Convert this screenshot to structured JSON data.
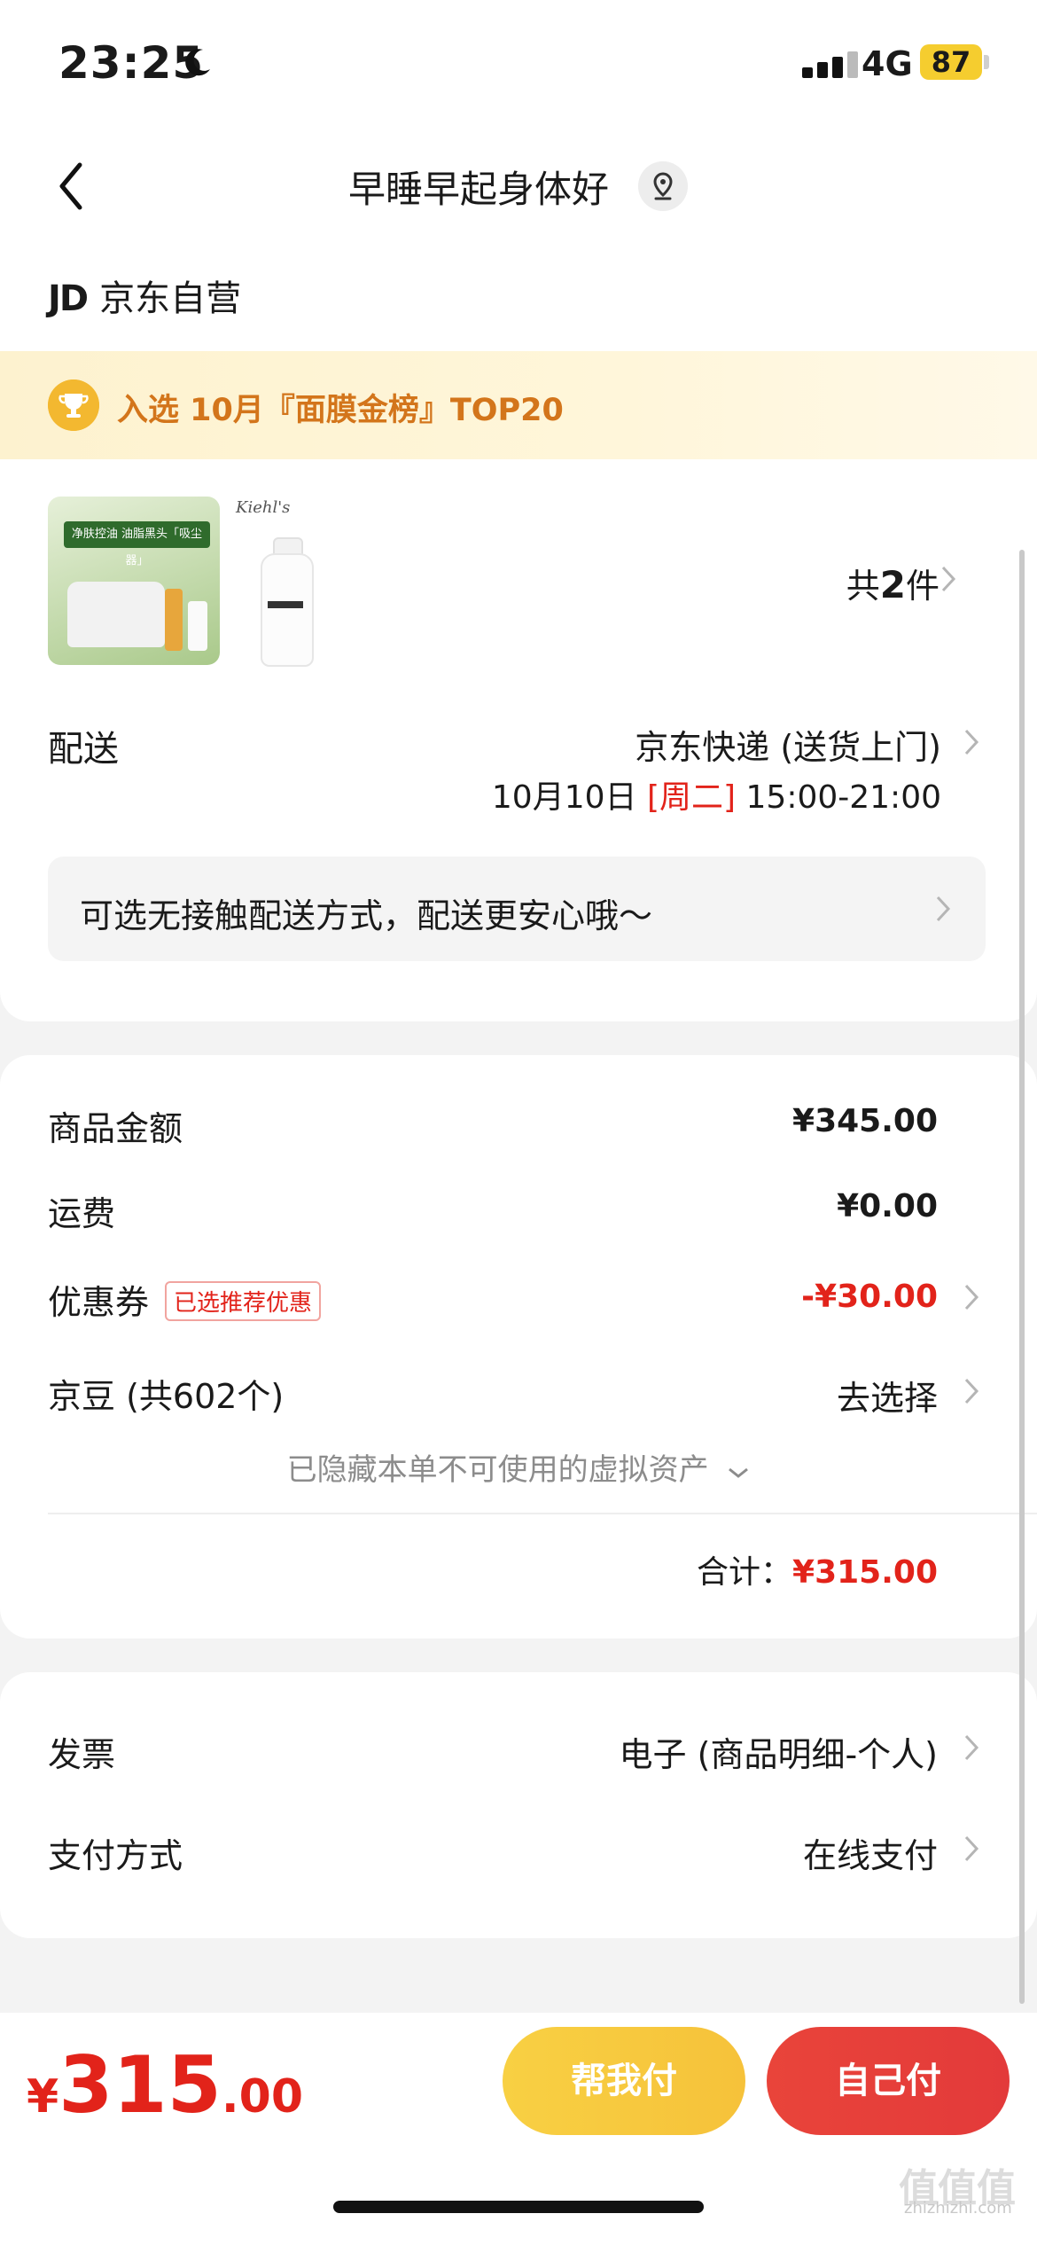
{
  "status_bar": {
    "time": "23:25",
    "network": "4G",
    "battery": "87"
  },
  "nav": {
    "title": "早睡早起身体好"
  },
  "store": {
    "logo": "JD",
    "name": "京东自营"
  },
  "banner": {
    "text": "入选 10月『面膜金榜』TOP20"
  },
  "products": {
    "count_prefix": "共",
    "count": "2",
    "count_suffix": "件",
    "thumb1_text": "净肤控油 油脂黑头「吸尘器」",
    "thumb2_brand": "Kiehl's"
  },
  "delivery": {
    "label": "配送",
    "method": "京东快递 (送货上门)",
    "date": "10月10日",
    "weekday": "[周二]",
    "time_window": "15:00-21:00",
    "contactless_hint": "可选无接触配送方式，配送更安心哦～"
  },
  "summary": {
    "goods_label": "商品金额",
    "goods_amount": "¥345.00",
    "shipping_label": "运费",
    "shipping_amount": "¥0.00",
    "coupon_label": "优惠券",
    "coupon_badge": "已选推荐优惠",
    "coupon_amount": "-¥30.00",
    "beans_label": "京豆 (共602个)",
    "beans_action": "去选择",
    "hidden_assets": "已隐藏本单不可使用的虚拟资产",
    "total_label": "合计：",
    "total_amount": "¥315.00"
  },
  "extras": {
    "invoice_label": "发票",
    "invoice_value": "电子 (商品明细-个人)",
    "payment_label": "支付方式",
    "payment_value": "在线支付"
  },
  "footer": {
    "currency": "¥",
    "price_int": "315",
    "price_dec": ".00",
    "help_pay": "帮我付",
    "self_pay": "自己付"
  },
  "watermark": {
    "domain": "zhizhizhi.com",
    "mark": "值值值"
  },
  "colors": {
    "accent_red": "#e2231a",
    "accent_yellow": "#f6c23a",
    "banner_text": "#d3751b"
  }
}
